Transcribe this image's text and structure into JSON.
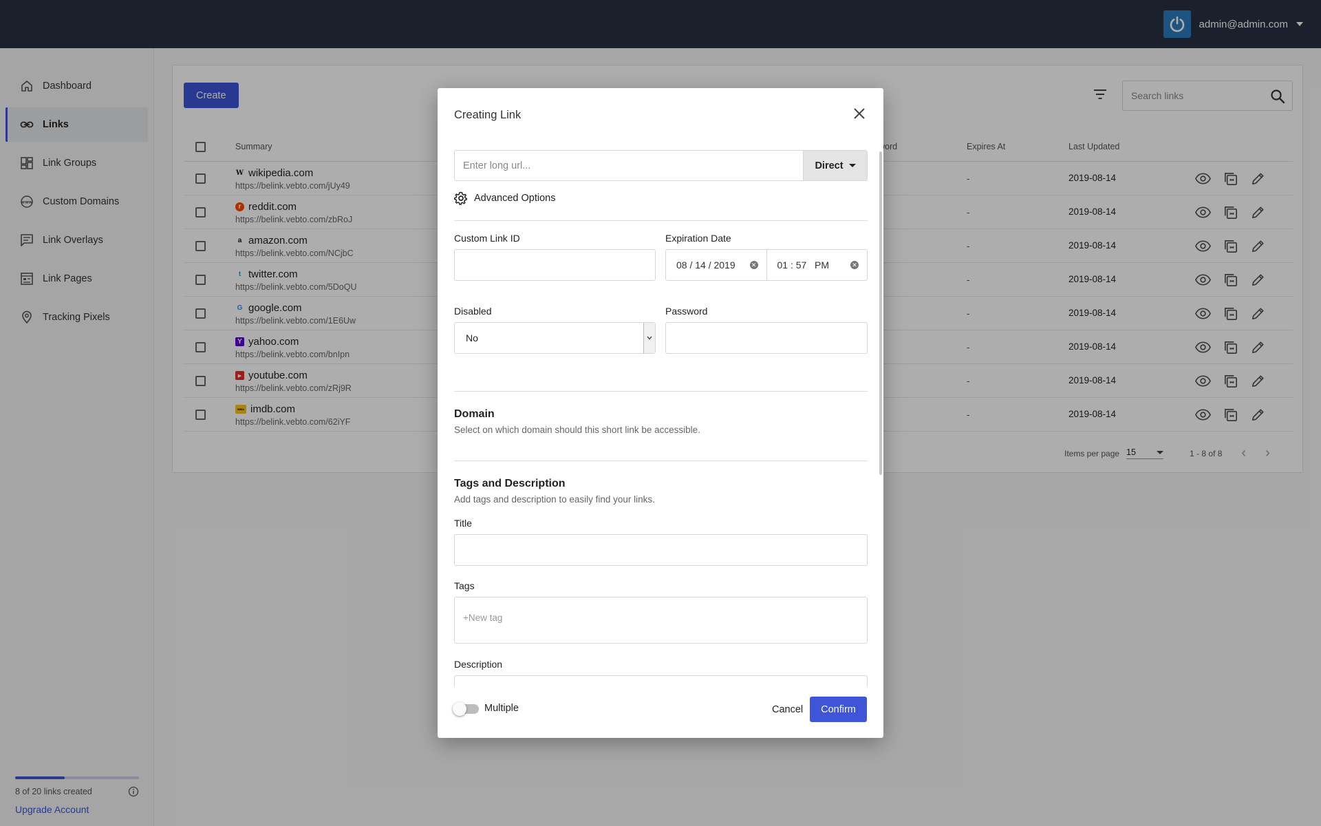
{
  "header": {
    "user_email": "admin@admin.com"
  },
  "sidebar": {
    "items": [
      {
        "label": "Dashboard",
        "icon": "home-icon"
      },
      {
        "label": "Links",
        "icon": "link-icon"
      },
      {
        "label": "Link Groups",
        "icon": "grid-icon"
      },
      {
        "label": "Custom Domains",
        "icon": "www-icon"
      },
      {
        "label": "Link Overlays",
        "icon": "message-icon"
      },
      {
        "label": "Link Pages",
        "icon": "page-icon"
      },
      {
        "label": "Tracking Pixels",
        "icon": "location-pin-icon"
      }
    ],
    "active_index": 1,
    "usage": {
      "text": "8 of 20 links created",
      "used": 8,
      "limit": 20
    },
    "upgrade_label": "Upgrade Account"
  },
  "toolbar": {
    "create_label": "Create",
    "search_placeholder": "Search links"
  },
  "table": {
    "columns": {
      "summary": "Summary",
      "password_partial": "word",
      "expires": "Expires At",
      "updated": "Last Updated"
    },
    "rows": [
      {
        "site": "wikipedia.com",
        "short": "https://belink.vebto.com/jUy49",
        "expires": "-",
        "updated": "2019-08-14",
        "favicon": "W"
      },
      {
        "site": "reddit.com",
        "short": "https://belink.vebto.com/zbRoJ",
        "expires": "-",
        "updated": "2019-08-14",
        "favicon": "r"
      },
      {
        "site": "amazon.com",
        "short": "https://belink.vebto.com/NCjbC",
        "expires": "-",
        "updated": "2019-08-14",
        "favicon": "a"
      },
      {
        "site": "twitter.com",
        "short": "https://belink.vebto.com/5DoQU",
        "expires": "-",
        "updated": "2019-08-14",
        "favicon": "t"
      },
      {
        "site": "google.com",
        "short": "https://belink.vebto.com/1E6Uw",
        "expires": "-",
        "updated": "2019-08-14",
        "favicon": "G"
      },
      {
        "site": "yahoo.com",
        "short": "https://belink.vebto.com/bnIpn",
        "expires": "-",
        "updated": "2019-08-14",
        "favicon": "Y"
      },
      {
        "site": "youtube.com",
        "short": "https://belink.vebto.com/zRj9R",
        "expires": "-",
        "updated": "2019-08-14",
        "favicon": "▶"
      },
      {
        "site": "imdb.com",
        "short": "https://belink.vebto.com/62iYF",
        "expires": "-",
        "updated": "2019-08-14",
        "favicon": "IMDb"
      }
    ],
    "pagination": {
      "items_per_page_label": "Items per page",
      "items_per_page": "15",
      "range": "1 - 8 of 8"
    }
  },
  "modal": {
    "title": "Creating Link",
    "url_placeholder": "Enter long url...",
    "type_label": "Direct",
    "advanced_label": "Advanced Options",
    "custom_id_label": "Custom Link ID",
    "custom_id_value": "",
    "expiration_label": "Expiration Date",
    "expiration_date": "08 / 14 / 2019",
    "expiration_time": "01 : 57   PM",
    "disabled_label": "Disabled",
    "disabled_value": "No",
    "password_label": "Password",
    "password_value": "",
    "domain_title": "Domain",
    "domain_sub": "Select on which domain should this short link be accessible.",
    "tags_title": "Tags and Description",
    "tags_sub": "Add tags and description to easily find your links.",
    "title_label": "Title",
    "title_value": "",
    "tags_label": "Tags",
    "tags_placeholder": "+New tag",
    "description_label": "Description",
    "multiple_label": "Multiple",
    "multiple_on": false,
    "cancel_label": "Cancel",
    "confirm_label": "Confirm"
  },
  "colors": {
    "accent": "#3d55d6",
    "topbar": "#283043",
    "avatar": "#2b7bbf"
  }
}
